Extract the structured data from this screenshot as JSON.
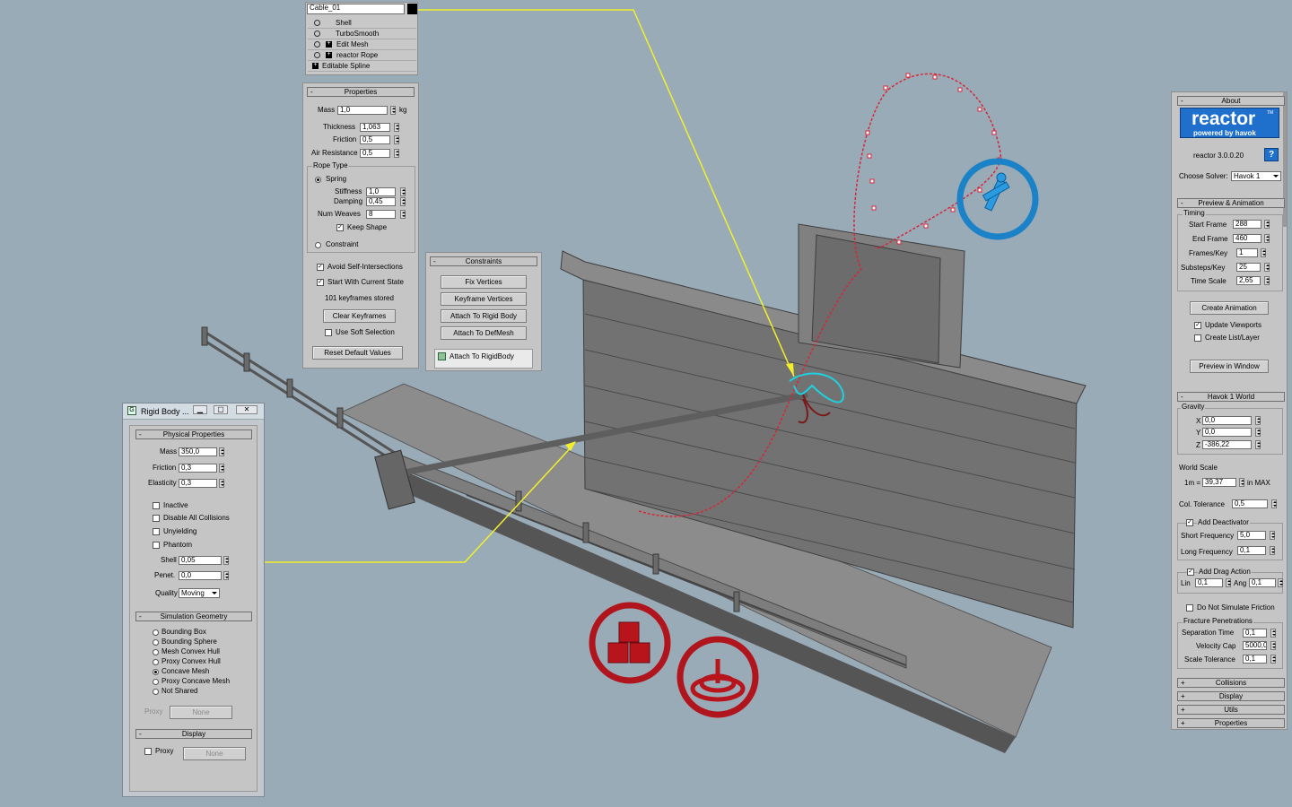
{
  "viewport": {
    "colors": {
      "background": "#9aabb8",
      "wall": "#6e6e6e",
      "rope_red": "#d6263a",
      "rope_blue": "#1c82c8",
      "accent_yellow": "#f2f02a",
      "ring_red": "#b0141c"
    }
  },
  "modifier_stack": {
    "object_name": "Cable_01",
    "items": [
      "Shell",
      "TurboSmooth",
      "Edit Mesh",
      "reactor Rope",
      "Editable Spline"
    ]
  },
  "properties": {
    "title": "Properties",
    "mass_label": "Mass",
    "mass_value": "1,0",
    "mass_unit": "kg",
    "thickness_label": "Thickness",
    "thickness_value": "1,063",
    "friction_label": "Friction",
    "friction_value": "0,5",
    "air_label": "Air Resistance",
    "air_value": "0,5",
    "rope_type_label": "Rope Type",
    "spring_label": "Spring",
    "stiffness_label": "Stiffness",
    "stiffness_value": "1,0",
    "damping_label": "Damping",
    "damping_value": "0,45",
    "weaves_label": "Num Weaves",
    "weaves_value": "8",
    "keep_shape_label": "Keep Shape",
    "constraint_label": "Constraint",
    "avoid_label": "Avoid Self-Intersections",
    "start_label": "Start With Current State",
    "keyframes_text": "101 keyframes stored",
    "clear_btn": "Clear Keyframes",
    "soft_label": "Use Soft Selection",
    "reset_btn": "Reset Default Values"
  },
  "constraints": {
    "title": "Constraints",
    "buttons": [
      "Fix Vertices",
      "Keyframe Vertices",
      "Attach To Rigid Body",
      "Attach To DefMesh"
    ],
    "item": "Attach To RigidBody"
  },
  "rigid_body": {
    "window_title": "Rigid Body ...",
    "physical_title": "Physical Properties",
    "mass_label": "Mass",
    "mass_value": "350,0",
    "friction_label": "Friction",
    "friction_value": "0,3",
    "elasticity_label": "Elasticity",
    "elasticity_value": "0,3",
    "inactive": "Inactive",
    "disable_all": "Disable All Collisions",
    "unyielding": "Unyielding",
    "phantom": "Phantom",
    "shell_label": "Shell",
    "shell_value": "0,05",
    "penet_label": "Penet.",
    "penet_value": "0,0",
    "quality_label": "Quality",
    "quality_value": "Moving",
    "sim_geom_title": "Simulation Geometry",
    "geom_options": [
      "Bounding Box",
      "Bounding Sphere",
      "Mesh Convex Hull",
      "Proxy Convex Hull",
      "Concave Mesh",
      "Proxy Concave Mesh",
      "Not Shared"
    ],
    "proxy_label": "Proxy",
    "proxy_btn": "None",
    "display_title": "Display",
    "display_proxy_label": "Proxy",
    "display_btn": "None"
  },
  "reactor": {
    "about_title": "About",
    "logo_text": "reactor",
    "logo_tm": "TM",
    "logo_sub": "powered by havok",
    "version": "reactor 3.0.0.20",
    "help_btn": "?",
    "solver_label": "Choose Solver:",
    "solver_value": "Havok 1",
    "preview_title": "Preview & Animation",
    "timing_label": "Timing",
    "start_frame_label": "Start Frame",
    "start_frame_value": "288",
    "end_frame_label": "End Frame",
    "end_frame_value": "460",
    "frames_key_label": "Frames/Key",
    "frames_key_value": "1",
    "substeps_label": "Substeps/Key",
    "substeps_value": "25",
    "time_scale_label": "Time Scale",
    "time_scale_value": "2,65",
    "create_anim_btn": "Create Animation",
    "update_vp_label": "Update Viewports",
    "create_list_label": "Create List/Layer",
    "preview_btn": "Preview in Window",
    "world_title": "Havok 1 World",
    "gravity_label": "Gravity",
    "gx_label": "X",
    "gx_value": "0,0",
    "gy_label": "Y",
    "gy_value": "0,0",
    "gz_label": "Z",
    "gz_value": "-386,22",
    "world_scale_label": "World Scale",
    "scale_1m": "1m =",
    "scale_value": "39,37",
    "scale_unit": "in MAX",
    "col_tol_label": "Col. Tolerance",
    "col_tol_value": "0,5",
    "add_deact_label": "Add Deactivator",
    "short_freq_label": "Short Frequency",
    "short_freq_value": "5,0",
    "long_freq_label": "Long Frequency",
    "long_freq_value": "0,1",
    "add_drag_label": "Add Drag Action",
    "lin_label": "Lin",
    "lin_value": "0,1",
    "ang_label": "Ang",
    "ang_value": "0,1",
    "no_friction_label": "Do Not Simulate Friction",
    "fracture_label": "Fracture Penetrations",
    "sep_time_label": "Separation Time",
    "sep_time_value": "0,1",
    "vel_cap_label": "Velocity Cap",
    "vel_cap_value": "5000,0",
    "scale_tol_label": "Scale Tolerance",
    "scale_tol_value": "0,1",
    "collapsed": [
      "Collisions",
      "Display",
      "Utils",
      "Properties"
    ]
  }
}
